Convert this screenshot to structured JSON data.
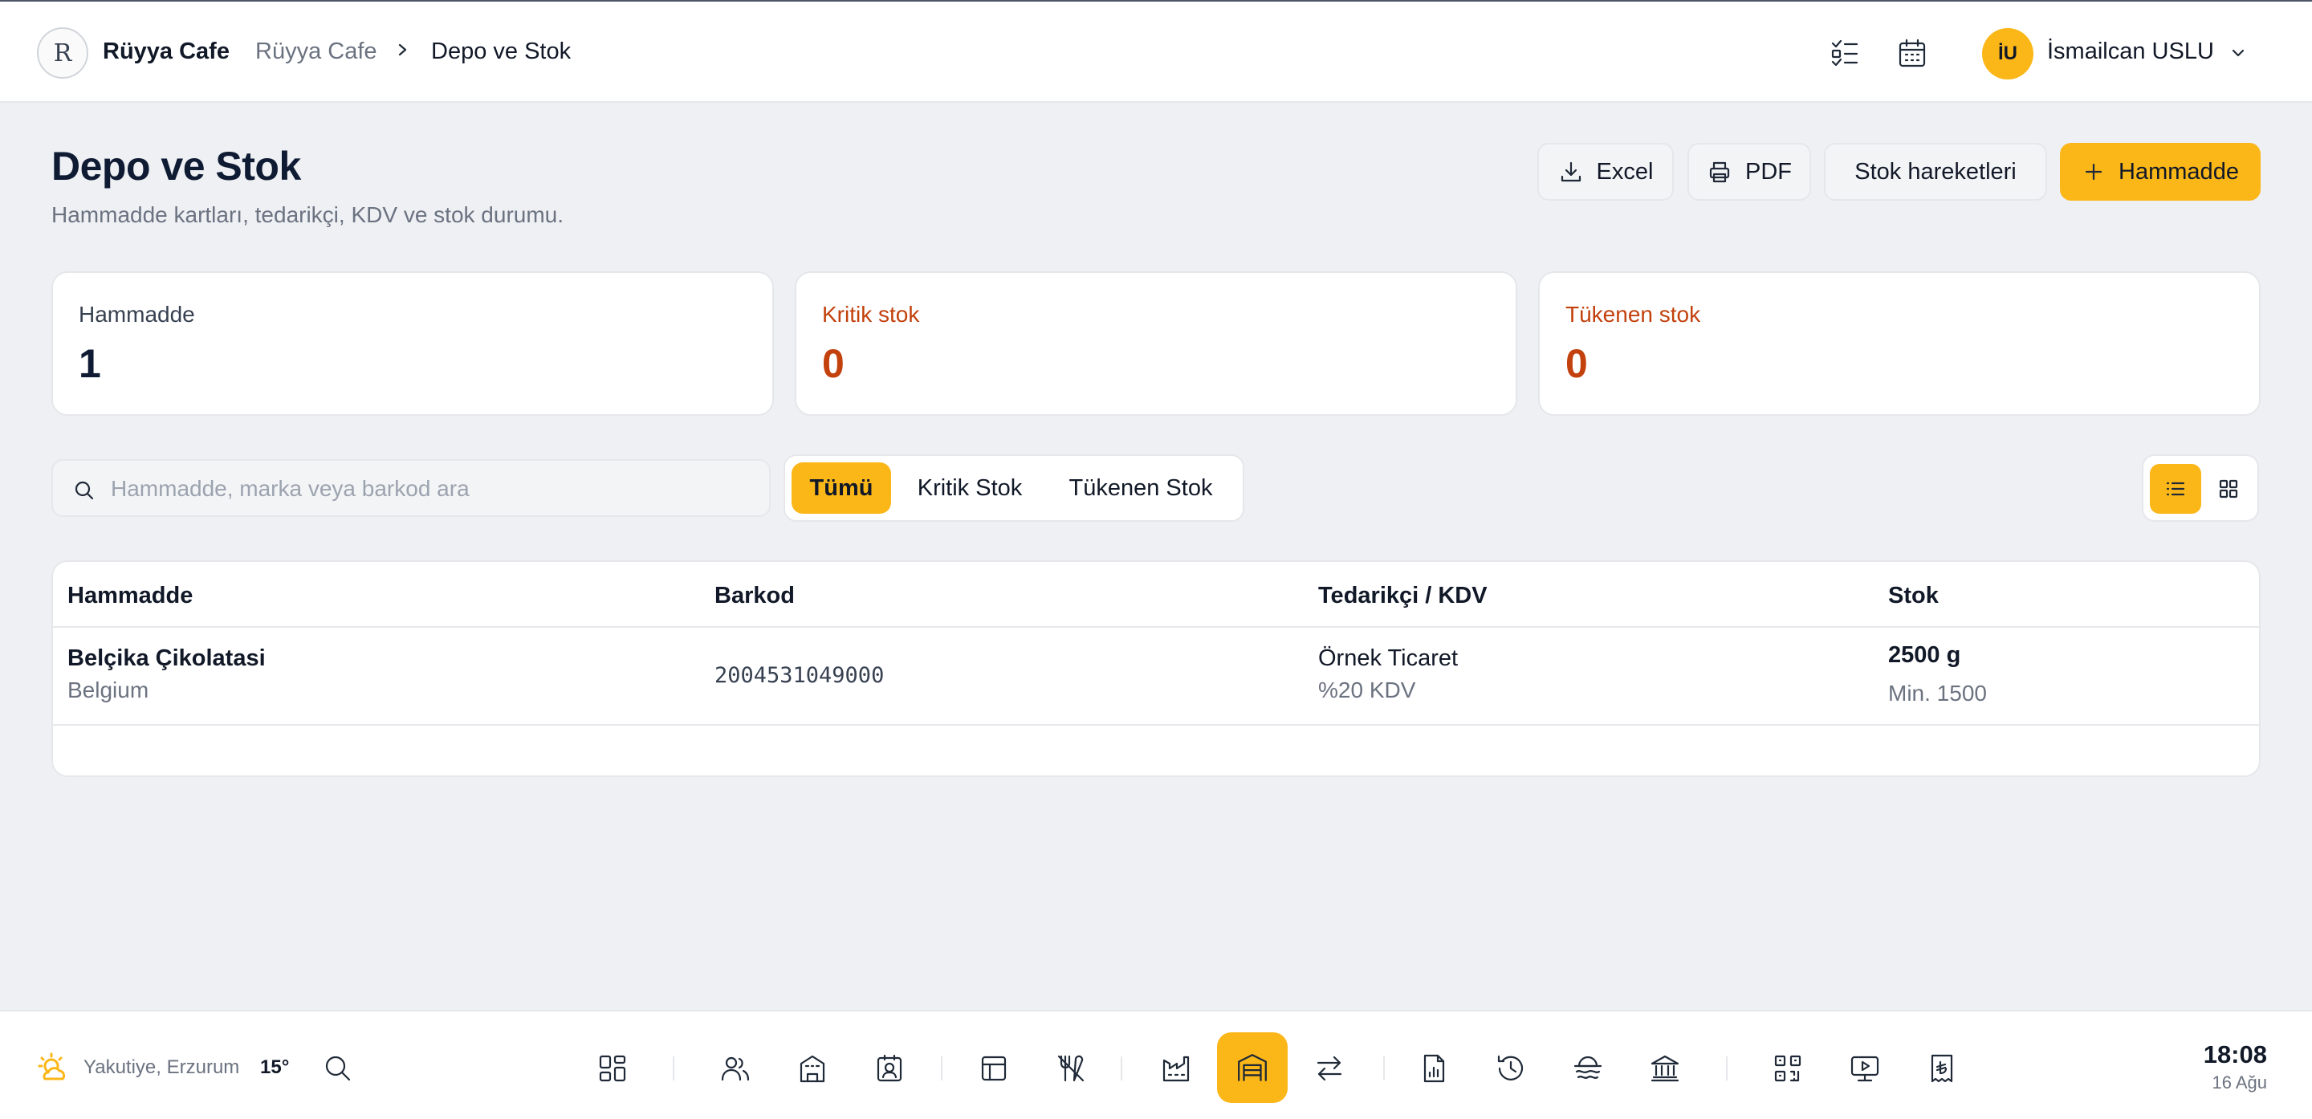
{
  "header": {
    "logo_mark": "R",
    "brand": "Rüyya Cafe",
    "breadcrumb": [
      "Rüyya Cafe",
      "Depo ve Stok"
    ],
    "user": {
      "initials": "İU",
      "name": "İsmailcan USLU"
    }
  },
  "page": {
    "title": "Depo ve Stok",
    "subtitle": "Hammadde kartları, tedarikçi, KDV ve stok durumu.",
    "actions": {
      "excel": "Excel",
      "pdf": "PDF",
      "movements": "Stok hareketleri",
      "add": "Hammadde"
    }
  },
  "stats": [
    {
      "label": "Hammadde",
      "value": "1"
    },
    {
      "label": "Kritik stok",
      "value": "0"
    },
    {
      "label": "Tükenen stok",
      "value": "0"
    }
  ],
  "search": {
    "placeholder": "Hammadde, marka veya barkod ara",
    "value": ""
  },
  "filters": [
    "Tümü",
    "Kritik Stok",
    "Tükenen Stok"
  ],
  "active_filter": "Tümü",
  "view_mode": "list",
  "table": {
    "columns": [
      "Hammadde",
      "Barkod",
      "Tedarikçi / KDV",
      "Stok"
    ],
    "rows": [
      {
        "name": "Belçika Çikolatasi",
        "brand": "Belgium",
        "barcode": "2004531049000",
        "supplier": "Örnek Ticaret",
        "vat": "%20 KDV",
        "stock": "2500 g",
        "min": "Min. 1500"
      }
    ]
  },
  "dock": {
    "weather": {
      "location": "Yakutiye, Erzurum",
      "temp": "15°",
      "icon": "sun-cloud-icon"
    },
    "icons": [
      "dashboard-icon",
      "users-icon",
      "building-icon",
      "contact-icon",
      "table-icon",
      "utensils-off-icon",
      "factory-icon",
      "warehouse-icon",
      "transfer-icon",
      "report-icon",
      "history-icon",
      "drift-icon",
      "bank-icon",
      "qr-icon",
      "screen-icon",
      "receipt-icon"
    ],
    "active_icon": "warehouse-icon",
    "clock": {
      "time": "18:08",
      "date": "16 Ağu"
    }
  },
  "colors": {
    "accent": "#fbb718",
    "warning": "#c2410c",
    "bg": "#eef0f4"
  }
}
